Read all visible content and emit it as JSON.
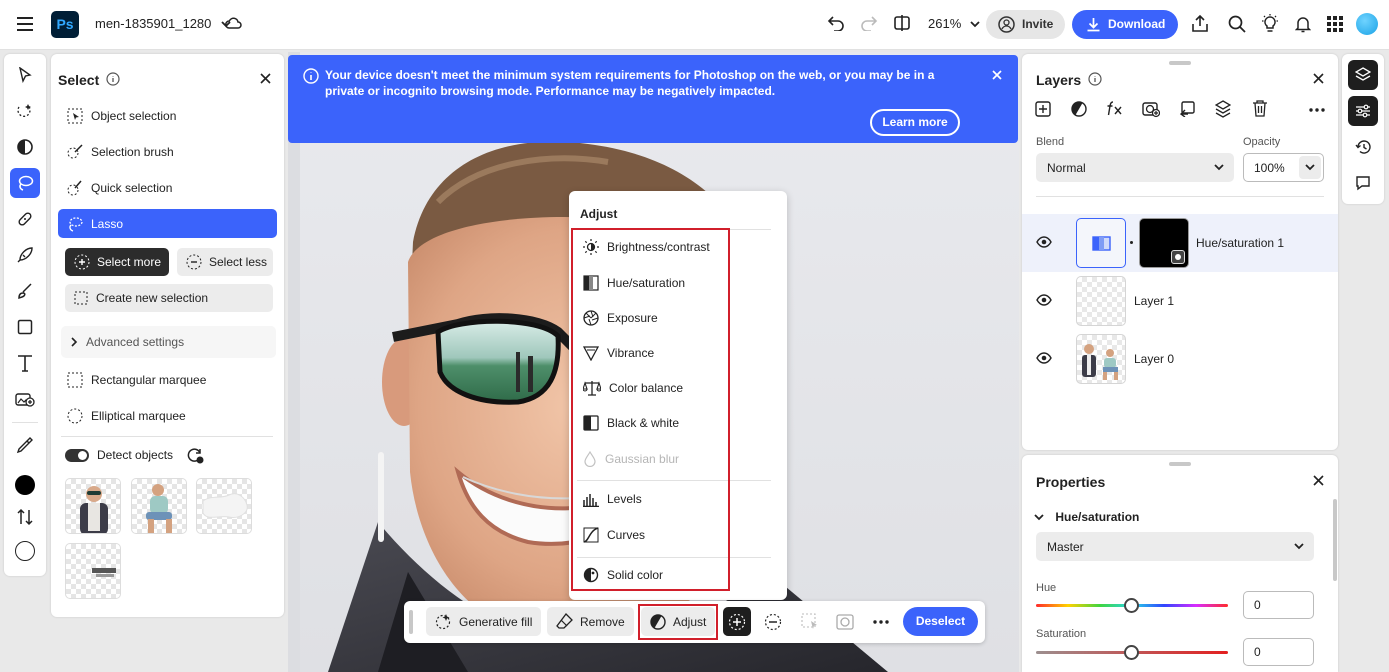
{
  "app": {
    "logo_text": "Ps",
    "document_title": "men-1835901_1280",
    "zoom": "261%",
    "invite_label": "Invite",
    "download_label": "Download"
  },
  "select_panel": {
    "title": "Select",
    "items": [
      {
        "label": "Object selection",
        "icon": "object-selection-icon"
      },
      {
        "label": "Selection brush",
        "icon": "selection-brush-icon"
      },
      {
        "label": "Quick selection",
        "icon": "quick-selection-icon"
      },
      {
        "label": "Lasso",
        "icon": "lasso-icon"
      }
    ],
    "select_more": "Select more",
    "select_less": "Select less",
    "create_new": "Create new selection",
    "advanced": "Advanced settings",
    "marquee_items": [
      {
        "label": "Rectangular marquee",
        "icon": "rectangular-marquee-icon"
      },
      {
        "label": "Elliptical marquee",
        "icon": "elliptical-marquee-icon"
      }
    ],
    "detect_objects": "Detect objects"
  },
  "banner": {
    "message": "Your device doesn't meet the minimum system requirements for Photoshop on the web, or you may be in a private or incognito browsing mode. Performance may be negatively impacted.",
    "learn_more": "Learn more"
  },
  "adjust_menu": {
    "title": "Adjust",
    "items": [
      {
        "label": "Brightness/contrast",
        "enabled": true
      },
      {
        "label": "Hue/saturation",
        "enabled": true
      },
      {
        "label": "Exposure",
        "enabled": true
      },
      {
        "label": "Vibrance",
        "enabled": true
      },
      {
        "label": "Color balance",
        "enabled": true
      },
      {
        "label": "Black & white",
        "enabled": true
      },
      {
        "label": "Gaussian blur",
        "enabled": false
      },
      {
        "label": "Levels",
        "enabled": true
      },
      {
        "label": "Curves",
        "enabled": true
      },
      {
        "label": "Solid color",
        "enabled": true
      }
    ]
  },
  "taskbar": {
    "generative_fill": "Generative fill",
    "remove": "Remove",
    "adjust": "Adjust",
    "deselect": "Deselect"
  },
  "layers_panel": {
    "title": "Layers",
    "blend_label": "Blend",
    "blend_value": "Normal",
    "opacity_label": "Opacity",
    "opacity_value": "100%",
    "layers": [
      {
        "name": "Hue/saturation 1",
        "active": true
      },
      {
        "name": "Layer 1",
        "active": false
      },
      {
        "name": "Layer 0",
        "active": false
      }
    ]
  },
  "properties_panel": {
    "title": "Properties",
    "section": "Hue/saturation",
    "channel": "Master",
    "hue_label": "Hue",
    "hue_value": "0",
    "saturation_label": "Saturation",
    "saturation_value": "0"
  },
  "colors": {
    "accent": "#3b63fb",
    "highlight_red": "#d11f2b",
    "foreground": "#000000",
    "background": "#ffffff"
  }
}
